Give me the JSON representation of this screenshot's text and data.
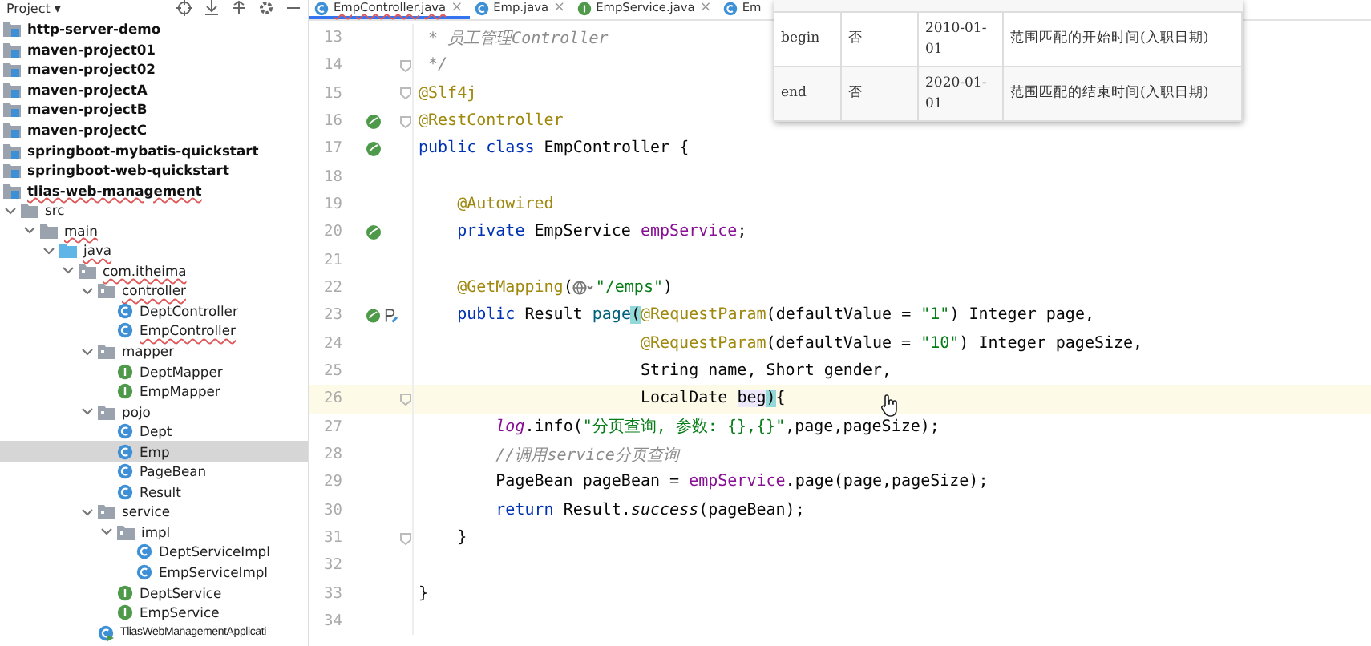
{
  "sidebar": {
    "title": "Project ▾",
    "tree": [
      {
        "label": "http-server-demo",
        "kind": "module",
        "selected": false
      },
      {
        "label": "maven-project01",
        "kind": "module",
        "selected": false
      },
      {
        "label": "maven-project02",
        "kind": "module",
        "selected": false
      },
      {
        "label": "maven-projectA",
        "kind": "module",
        "selected": false
      },
      {
        "label": "maven-projectB",
        "kind": "module",
        "selected": false
      },
      {
        "label": "maven-projectC",
        "kind": "module",
        "selected": false
      },
      {
        "label": "springboot-mybatis-quickstart",
        "kind": "module",
        "selected": false
      },
      {
        "label": "springboot-web-quickstart",
        "kind": "module",
        "selected": false
      },
      {
        "label": "tlias-web-management",
        "kind": "module",
        "selected": false,
        "misspelled": true
      },
      {
        "label": "src",
        "kind": "folder",
        "selected": false,
        "expanded": true,
        "children": [
          {
            "label": "main",
            "kind": "folder",
            "selected": false,
            "expanded": true,
            "misspelled": true,
            "children": [
              {
                "label": "java",
                "kind": "source",
                "selected": false,
                "expanded": true,
                "misspelled": true,
                "children": [
                  {
                    "label": "com.itheima",
                    "kind": "package",
                    "selected": false,
                    "expanded": true,
                    "misspelled": true,
                    "children": [
                      {
                        "label": "controller",
                        "kind": "package",
                        "selected": false,
                        "expanded": true,
                        "misspelled": true,
                        "children": [
                          {
                            "label": "DeptController",
                            "kind": "class",
                            "selected": false
                          },
                          {
                            "label": "EmpController",
                            "kind": "class",
                            "selected": false,
                            "misspelled": true
                          }
                        ]
                      },
                      {
                        "label": "mapper",
                        "kind": "package",
                        "selected": false,
                        "expanded": true,
                        "children": [
                          {
                            "label": "DeptMapper",
                            "kind": "interface",
                            "selected": false
                          },
                          {
                            "label": "EmpMapper",
                            "kind": "interface",
                            "selected": false
                          }
                        ]
                      },
                      {
                        "label": "pojo",
                        "kind": "package",
                        "selected": false,
                        "expanded": true,
                        "children": [
                          {
                            "label": "Dept",
                            "kind": "class",
                            "selected": false
                          },
                          {
                            "label": "Emp",
                            "kind": "class",
                            "selected": true
                          },
                          {
                            "label": "PageBean",
                            "kind": "class",
                            "selected": false
                          },
                          {
                            "label": "Result",
                            "kind": "class",
                            "selected": false
                          }
                        ]
                      },
                      {
                        "label": "service",
                        "kind": "package",
                        "selected": false,
                        "expanded": true,
                        "children": [
                          {
                            "label": "impl",
                            "kind": "package",
                            "selected": false,
                            "expanded": true,
                            "children": [
                              {
                                "label": "DeptServiceImpl",
                                "kind": "class",
                                "selected": false
                              },
                              {
                                "label": "EmpServiceImpl",
                                "kind": "class",
                                "selected": false
                              }
                            ]
                          },
                          {
                            "label": "DeptService",
                            "kind": "interface",
                            "selected": false
                          },
                          {
                            "label": "EmpService",
                            "kind": "interface",
                            "selected": false
                          }
                        ]
                      },
                      {
                        "label": "TliasWebManagementApplicati",
                        "kind": "app",
                        "selected": false
                      }
                    ]
                  }
                ]
              }
            ]
          }
        ]
      }
    ]
  },
  "tabs": [
    {
      "label": "EmpController.java",
      "kind": "class",
      "selected": true,
      "close": "×"
    },
    {
      "label": "Emp.java",
      "kind": "class",
      "selected": false,
      "close": "×"
    },
    {
      "label": "EmpService.java",
      "kind": "interface",
      "selected": false,
      "close": "×"
    },
    {
      "label": "Em",
      "kind": "class",
      "selected": false
    }
  ],
  "editor": {
    "lines": [
      {
        "number": "13",
        "tokens": [
          {
            "text": " * 员工管理Controller",
            "kind": "comment"
          }
        ]
      },
      {
        "number": "14",
        "fold": true,
        "tokens": [
          {
            "text": " */",
            "kind": "comment"
          }
        ]
      },
      {
        "number": "15",
        "fold": true,
        "tokens": [
          {
            "text": "@Slf4j",
            "kind": "annotation"
          }
        ]
      },
      {
        "number": "16",
        "fold": true,
        "gutter": [
          {
            "kind": "bean"
          }
        ],
        "tokens": [
          {
            "text": "@RestController",
            "kind": "annotation"
          }
        ]
      },
      {
        "number": "17",
        "gutter": [
          {
            "kind": "bean"
          }
        ],
        "tokens": [
          {
            "text": "public class ",
            "kind": "keyword"
          },
          {
            "text": "EmpController {",
            "kind": "plain"
          }
        ]
      },
      {
        "number": "18"
      },
      {
        "number": "19",
        "tokens": [
          {
            "text": "    @Autowired",
            "kind": "annotation"
          }
        ]
      },
      {
        "number": "20",
        "gutter": [
          {
            "kind": "bean"
          }
        ],
        "tokens": [
          {
            "text": "    private ",
            "kind": "keyword"
          },
          {
            "text": "EmpService ",
            "kind": "plain"
          },
          {
            "text": "empService",
            "kind": "field"
          },
          {
            "text": ";",
            "kind": "plain"
          }
        ]
      },
      {
        "number": "21"
      },
      {
        "number": "22",
        "tokens": [
          {
            "text": "    @GetMapping",
            "kind": "annotation"
          },
          {
            "text": "(",
            "kind": "plain"
          },
          {
            "kind": "globe"
          },
          {
            "text": "\"/emps\"",
            "kind": "string"
          },
          {
            "text": ")",
            "kind": "plain"
          }
        ]
      },
      {
        "number": "23",
        "gutter": [
          {
            "kind": "bean"
          },
          {
            "kind": "param"
          }
        ],
        "tokens": [
          {
            "text": "    public ",
            "kind": "keyword"
          },
          {
            "text": "Result ",
            "kind": "plain"
          },
          {
            "text": "page",
            "kind": "method"
          },
          {
            "text": "(",
            "kind": "match"
          },
          {
            "text": "@RequestParam",
            "kind": "annotation"
          },
          {
            "text": "(defaultValue = ",
            "kind": "plain"
          },
          {
            "text": "\"1\"",
            "kind": "string"
          },
          {
            "text": ") Integer page,",
            "kind": "plain"
          }
        ]
      },
      {
        "number": "24",
        "tokens": [
          {
            "text": "                       @RequestParam",
            "kind": "annotation"
          },
          {
            "text": "(defaultValue = ",
            "kind": "plain"
          },
          {
            "text": "\"10\"",
            "kind": "string"
          },
          {
            "text": ") Integer pageSize,",
            "kind": "plain"
          }
        ]
      },
      {
        "number": "25",
        "tokens": [
          {
            "text": "                       String name, Short gender,",
            "kind": "plain"
          }
        ]
      },
      {
        "number": "26",
        "current": true,
        "fold": true,
        "tokens": [
          {
            "text": "                       LocalDate ",
            "kind": "plain"
          },
          {
            "text": "beg",
            "kind": "typed"
          },
          {
            "text": ")",
            "kind": "match"
          },
          {
            "text": "{",
            "kind": "plain"
          }
        ]
      },
      {
        "number": "27",
        "tokens": [
          {
            "text": "        log",
            "kind": "static"
          },
          {
            "text": ".info(",
            "kind": "plain"
          },
          {
            "text": "\"分页查询, 参数: {},{}\"",
            "kind": "string"
          },
          {
            "text": ",page,pageSize);",
            "kind": "plain"
          }
        ]
      },
      {
        "number": "28",
        "tokens": [
          {
            "text": "        //调用service分页查询",
            "kind": "comment"
          }
        ]
      },
      {
        "number": "29",
        "tokens": [
          {
            "text": "        PageBean pageBean = ",
            "kind": "plain"
          },
          {
            "text": "empService",
            "kind": "field"
          },
          {
            "text": ".page(page,pageSize);",
            "kind": "plain"
          }
        ]
      },
      {
        "number": "30",
        "tokens": [
          {
            "text": "        return ",
            "kind": "keyword"
          },
          {
            "text": "Result.",
            "kind": "plain"
          },
          {
            "text": "success",
            "kind": "staticmethod"
          },
          {
            "text": "(pageBean);",
            "kind": "plain"
          }
        ]
      },
      {
        "number": "31",
        "fold": true,
        "tokens": [
          {
            "text": "    }",
            "kind": "plain"
          }
        ]
      },
      {
        "number": "32"
      },
      {
        "number": "33",
        "tokens": [
          {
            "text": "}",
            "kind": "plain"
          }
        ]
      },
      {
        "number": "34"
      }
    ]
  },
  "overlay_table": {
    "rows": [
      [
        "begin",
        "否",
        "2010-01-01",
        "范围匹配的开始时间(入职日期)"
      ],
      [
        "end",
        "否",
        "2020-01-01",
        "范围匹配的结束时间(入职日期)"
      ]
    ]
  }
}
